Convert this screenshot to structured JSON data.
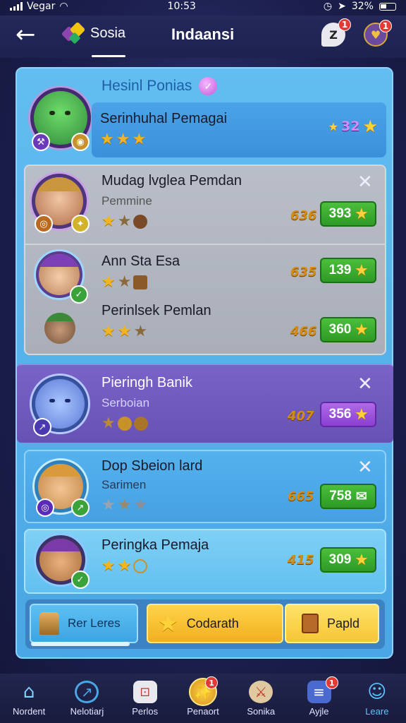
{
  "status": {
    "carrier": "Vegar",
    "time": "10:53",
    "battery": "32%"
  },
  "header": {
    "tab_label": "Sosia",
    "title": "Indaansi",
    "bubble_text": "Z",
    "bubble_badge": "1",
    "shield_badge": "1"
  },
  "panel": {
    "title": "Hesinl Ponias"
  },
  "top_card": {
    "name": "Serinhuhal Pemagai",
    "score": "32"
  },
  "cards": [
    {
      "name": "Mudag lvglea Pemdan",
      "sub": "Pemmine",
      "coin": "636",
      "value": "393"
    },
    {
      "name": "Ann Sta Esa",
      "sub": "",
      "coin": "635",
      "value": "139"
    },
    {
      "name": "Perinlsek Pemlan",
      "sub": "",
      "coin": "466",
      "value": "360"
    },
    {
      "name": "Pieringh Banik",
      "sub": "Serboian",
      "coin": "407",
      "value": "356"
    },
    {
      "name": "Dop Sbeion lard",
      "sub": "Sarimen",
      "coin": "665",
      "value": "758"
    },
    {
      "name": "Peringka Pemaja",
      "sub": "",
      "coin": "415",
      "value": "309"
    }
  ],
  "buttons": {
    "b1": "Rer Leres",
    "b2": "Codarath",
    "b3": "Papld"
  },
  "nav": [
    {
      "label": "Nordent",
      "icon": "home-icon"
    },
    {
      "label": "Nelotiarj",
      "icon": "compass-icon"
    },
    {
      "label": "Perlos",
      "icon": "dice-icon"
    },
    {
      "label": "Penaort",
      "icon": "coin-icon",
      "badge": "1"
    },
    {
      "label": "Sonika",
      "icon": "crossed-swords-icon"
    },
    {
      "label": "Ayjle",
      "icon": "inbox-icon",
      "badge": "1"
    },
    {
      "label": "Leare",
      "icon": "user-icon"
    }
  ]
}
